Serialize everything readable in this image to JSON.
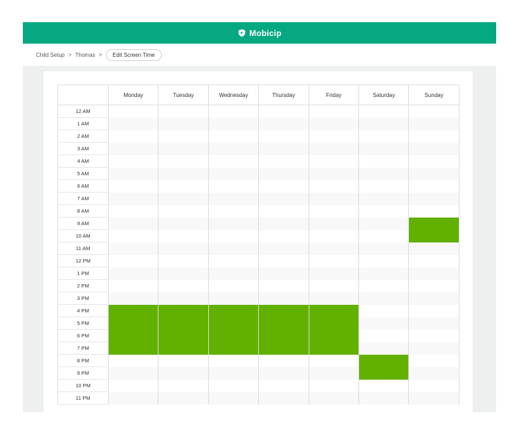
{
  "app": {
    "brand": "Mobicip",
    "accent": "#05a880"
  },
  "breadcrumb": {
    "items": [
      "Child Setup",
      "Thomas"
    ],
    "current": "Edit Screen Time"
  },
  "schedule": {
    "days": [
      "Monday",
      "Tuesday",
      "Wednesday",
      "Thursday",
      "Friday",
      "Saturday",
      "Sunday"
    ],
    "hours": [
      "12 AM",
      "1 AM",
      "2 AM",
      "3 AM",
      "4 AM",
      "5 AM",
      "6 AM",
      "7 AM",
      "8 AM",
      "9 AM",
      "10 AM",
      "11 AM",
      "12 PM",
      "1 PM",
      "2 PM",
      "3 PM",
      "4 PM",
      "5 PM",
      "6 PM",
      "7 PM",
      "8 PM",
      "9 PM",
      "10 PM",
      "11 PM"
    ],
    "allowed_color": "#62b000",
    "allowed": {
      "Monday": [
        16,
        17,
        18,
        19
      ],
      "Tuesday": [
        16,
        17,
        18,
        19
      ],
      "Wednesday": [
        16,
        17,
        18,
        19
      ],
      "Thursday": [
        16,
        17,
        18,
        19
      ],
      "Friday": [
        16,
        17,
        18,
        19
      ],
      "Saturday": [
        20,
        21
      ],
      "Sunday": [
        9,
        10
      ]
    }
  }
}
